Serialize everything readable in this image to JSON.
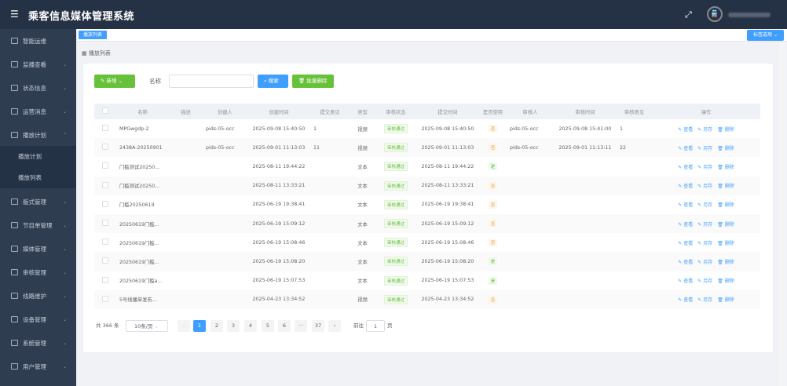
{
  "app": {
    "title": "乘客信息媒体管理系统",
    "menu_icon": "hamburger-icon",
    "fullscreen_icon": "expand-icon",
    "avatar_icon": "train-icon"
  },
  "sidebar": {
    "items": [
      {
        "label": "智能运维",
        "icon": "calendar-icon",
        "expandable": false
      },
      {
        "label": "监播查看",
        "icon": "calendar-icon",
        "expandable": true
      },
      {
        "label": "状态信息",
        "icon": "monitor-icon",
        "expandable": true
      },
      {
        "label": "运营消息",
        "icon": "document-icon",
        "expandable": true
      },
      {
        "label": "播放计划",
        "icon": "calendar-icon",
        "expandable": true,
        "expanded": true,
        "children": [
          {
            "label": "播放计划"
          },
          {
            "label": "播放列表"
          }
        ]
      },
      {
        "label": "版式管理",
        "icon": "layout-icon",
        "expandable": true
      },
      {
        "label": "节目单管理",
        "icon": "list-icon",
        "expandable": true
      },
      {
        "label": "媒体管理",
        "icon": "media-icon",
        "expandable": true
      },
      {
        "label": "审核管理",
        "icon": "audit-icon",
        "expandable": true
      },
      {
        "label": "线路维护",
        "icon": "route-icon",
        "expandable": true
      },
      {
        "label": "设备管理",
        "icon": "device-icon",
        "expandable": true
      },
      {
        "label": "系统管理",
        "icon": "gear-icon",
        "expandable": true
      },
      {
        "label": "用户管理",
        "icon": "user-icon",
        "expandable": true
      }
    ]
  },
  "tabs": {
    "active": "播放列表",
    "options": "标签选项"
  },
  "breadcrumb": "播放列表",
  "toolbar": {
    "add": "新增",
    "name_label": "名称",
    "name_placeholder": "",
    "search": "搜索",
    "batch_delete": "批量删除"
  },
  "table": {
    "headers": [
      "名称",
      "描述",
      "创建人",
      "创建时间",
      "提交意见",
      "类型",
      "审核状态",
      "提交时间",
      "是否使用",
      "审核人",
      "审核时间",
      "审核意见",
      "操作"
    ],
    "actions": [
      "查看",
      "另存",
      "删除"
    ],
    "rows": [
      [
        "MPGwgdp-2",
        "",
        "pids-05-occ",
        "2025-09-08 15:40:50",
        "1",
        "视频",
        "审核通过",
        "2025-09-08 15:40:50",
        "否",
        "pids-05-occ",
        "2025-09-08 15:41:00",
        "1"
      ],
      [
        "2438A-20250901",
        "",
        "pids-05-occ",
        "2025-09-01 11:13:03",
        "11",
        "视频",
        "审核通过",
        "2025-09-01 11:13:03",
        "否",
        "pids-05-occ",
        "2025-09-01 11:13:11",
        "22"
      ],
      [
        "门槛测试20250...",
        "",
        "",
        "2025-08-11 19:44:22",
        "",
        "文本",
        "审核通过",
        "2025-08-11 19:44:22",
        "是",
        "",
        "",
        ""
      ],
      [
        "门槛测试20250...",
        "",
        "",
        "2025-08-11 13:33:21",
        "",
        "文本",
        "审核通过",
        "2025-08-11 13:33:21",
        "否",
        "",
        "",
        ""
      ],
      [
        "门槛20250619",
        "",
        "",
        "2025-06-19 19:38:41",
        "",
        "文本",
        "审核通过",
        "2025-06-19 19:38:41",
        "否",
        "",
        "",
        ""
      ],
      [
        "20250619门槛...",
        "",
        "",
        "2025-06-19 15:09:12",
        "",
        "文本",
        "审核通过",
        "2025-06-19 15:09:12",
        "否",
        "",
        "",
        ""
      ],
      [
        "20250619门槛...",
        "",
        "",
        "2025-06-19 15:08:46",
        "",
        "文本",
        "审核通过",
        "2025-06-19 15:08:46",
        "否",
        "",
        "",
        ""
      ],
      [
        "20250619门槛...",
        "",
        "",
        "2025-06-19 15:08:20",
        "",
        "文本",
        "审核通过",
        "2025-06-19 15:08:20",
        "是",
        "",
        "",
        ""
      ],
      [
        "20250619门槛a...",
        "",
        "",
        "2025-06-19 15:07:53",
        "",
        "文本",
        "审核通过",
        "2025-06-19 15:07:53",
        "是",
        "",
        "",
        ""
      ],
      [
        "5号线播单发布...",
        "",
        "",
        "2025-04-23 13:34:52",
        "",
        "视频",
        "审核通过",
        "2025-04-23 13:34:52",
        "否",
        "",
        "",
        ""
      ]
    ]
  },
  "pagination": {
    "total": "共 366 条",
    "page_size": "10条/页",
    "pages": [
      "1",
      "2",
      "3",
      "4",
      "5",
      "6",
      "···",
      "37"
    ],
    "current": "1",
    "goto_label": "前往",
    "goto_value": "1",
    "page_unit": "页"
  },
  "colors": {
    "header": "#253245",
    "sidebar": "#2f3d51",
    "primary": "#409eff",
    "success": "#67c23a",
    "warning": "#e6a23c"
  }
}
